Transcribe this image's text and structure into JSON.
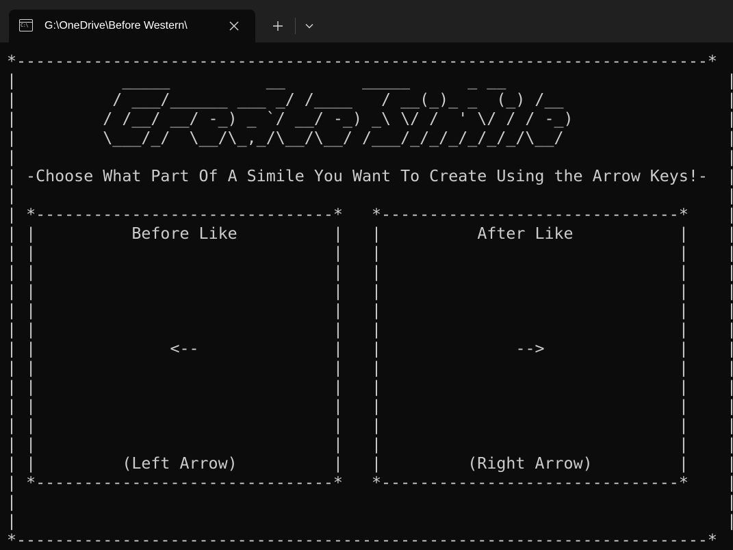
{
  "window": {
    "tab_title": "G:\\OneDrive\\Before Western\\",
    "tab_icon": "terminal-icon",
    "icon_glyph": "C:\\",
    "close_icon": "close-icon",
    "new_tab_icon": "plus-icon",
    "dropdown_icon": "chevron-down-icon"
  },
  "terminal": {
    "border_top": "*------------------------------------------------------------------------*",
    "border_bottom": "*------------------------------------------------------------------------*",
    "logo_lines": [
      "           _____          __        _____      _ __",
      "          / ___/______ ___ _/ /____   / __(_)_ _  (_) /__",
      "         / /__/ __/ -_) _ `/ __/ -_) _\\ \\/ /  ' \\/ / / -_)",
      "         \\___/_/  \\__/\\_,_/\\__/\\__/ /___/_/_/_/_/_/_/\\__/"
    ],
    "instruction": "-Choose What Part Of A Simile You Want To Create Using the Arrow Keys!-",
    "left_box": {
      "title": "Before Like",
      "arrow": "<--",
      "hint": "(Left Arrow)"
    },
    "right_box": {
      "title": "After Like",
      "arrow": "-->",
      "hint": "(Right Arrow)"
    }
  }
}
